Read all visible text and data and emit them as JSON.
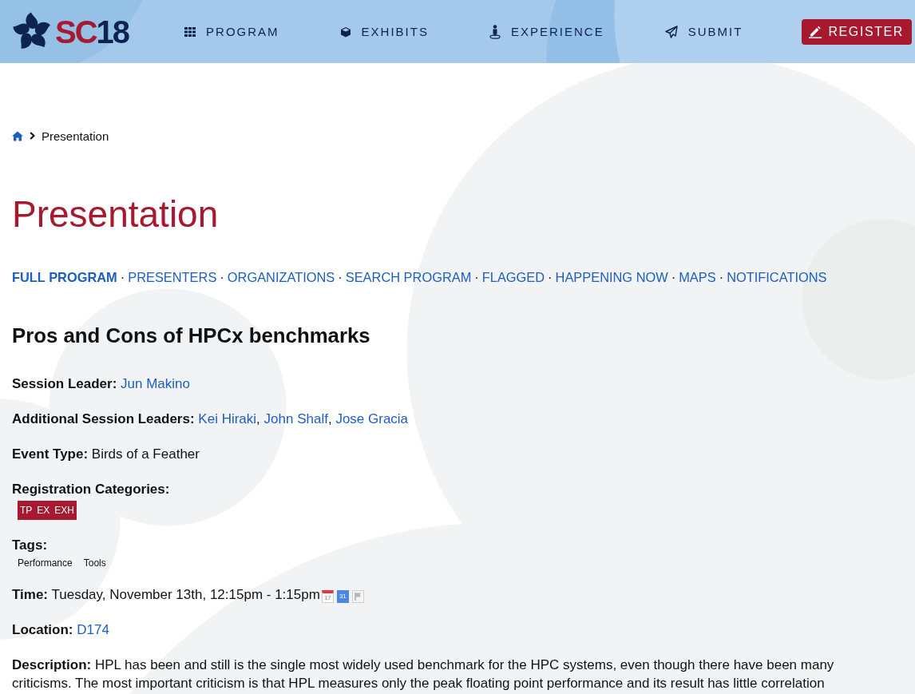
{
  "header": {
    "logo": {
      "parts": [
        {
          "text": "SC",
          "color": "#a6192e"
        },
        {
          "text": "18",
          "color": "#0d2350"
        }
      ]
    },
    "nav": [
      {
        "label": "PROGRAM",
        "kind": "grid"
      },
      {
        "label": "EXHIBITS",
        "kind": "cube"
      },
      {
        "label": "EXPERIENCE",
        "kind": "person"
      },
      {
        "label": "SUBMIT",
        "kind": "plane"
      }
    ],
    "register": {
      "label": "REGISTER"
    }
  },
  "breadcrumb": {
    "current": "Presentation"
  },
  "page_title": "Presentation",
  "program_links": {
    "separator": "·",
    "items": [
      {
        "label": "FULL PROGRAM",
        "selected": true
      },
      {
        "label": "PRESENTERS",
        "selected": false
      },
      {
        "label": "ORGANIZATIONS",
        "selected": false
      },
      {
        "label": "SEARCH PROGRAM",
        "selected": false
      },
      {
        "label": "FLAGGED",
        "selected": false
      },
      {
        "label": "HAPPENING NOW",
        "selected": false
      },
      {
        "label": "MAPS",
        "selected": false
      },
      {
        "label": "NOTIFICATIONS",
        "selected": false
      }
    ]
  },
  "session": {
    "title": "Pros and Cons of HPCx benchmarks",
    "details": [
      {
        "kind": "links",
        "label": "Session Leader:",
        "links": [
          "Jun Makino"
        ]
      },
      {
        "kind": "links",
        "label": "Additional Session Leaders:",
        "separator": ",",
        "links": [
          "Kei Hiraki",
          "John Shalf",
          "Jose Gracia"
        ]
      },
      {
        "kind": "text",
        "label": "Event Type:",
        "value": "Birds of a Feather"
      },
      {
        "kind": "badges",
        "label": "Registration Categories:",
        "badges": [
          "TP",
          "EX",
          "EXH"
        ]
      },
      {
        "kind": "tags",
        "label": "Tags:",
        "tags": [
          "Performance",
          "Tools"
        ]
      },
      {
        "kind": "time",
        "label": "Time:",
        "value": "Tuesday, November 13th, 12:15pm - 1:15pm",
        "icons": [
          {
            "kind": "calendar",
            "day": "17"
          },
          {
            "kind": "google_calendar",
            "day": "31"
          },
          {
            "kind": "flag"
          }
        ]
      },
      {
        "kind": "links",
        "label": "Location:",
        "links": [
          "D174"
        ]
      },
      {
        "kind": "paragraph",
        "text": "**Description:** HPL has been and still is the single most widely used benchmark for the HPC systems, even though there have been many criticisms. The most important criticism is that HPL measures only the peak floating point performance and its result has little correlation"
      }
    ]
  }
}
